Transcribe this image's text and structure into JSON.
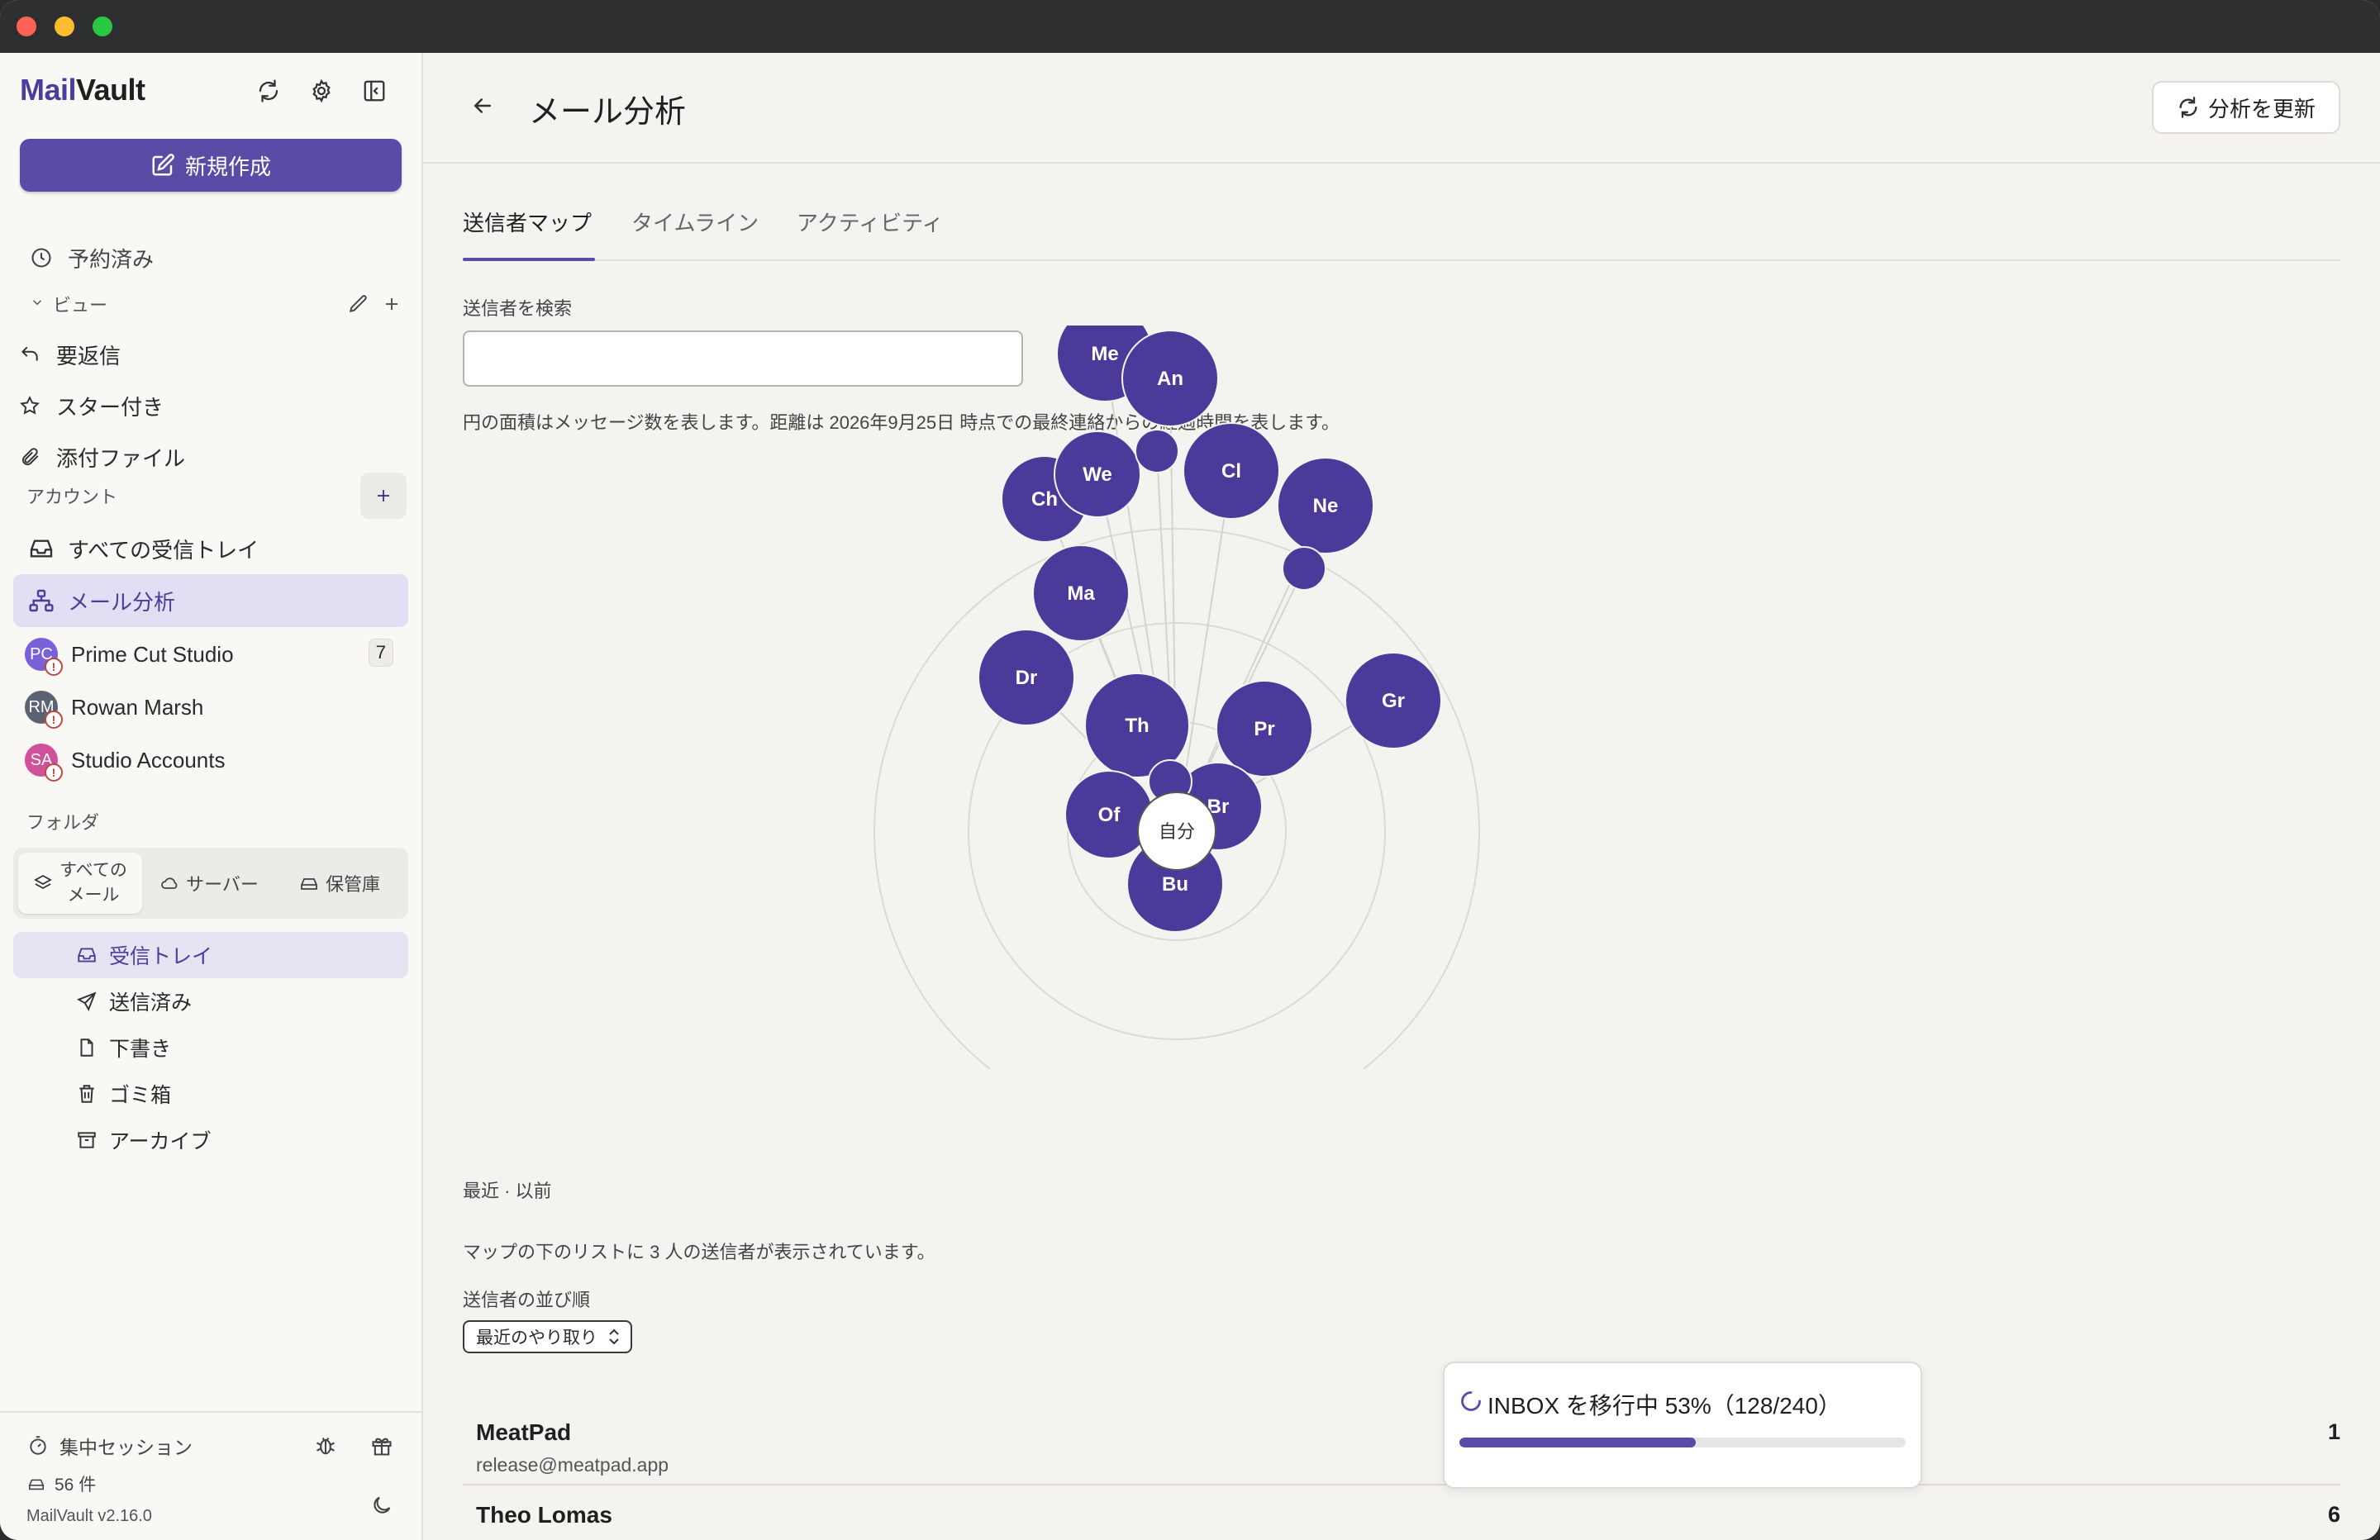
{
  "app": {
    "logo_part1": "Mail",
    "logo_part2": "Vault"
  },
  "sidebar": {
    "compose_label": "新規作成",
    "scheduled_label": "予約済み",
    "views_label": "ビュー",
    "views": [
      {
        "label": "要返信",
        "icon": "reply-icon"
      },
      {
        "label": "スター付き",
        "icon": "star-icon"
      },
      {
        "label": "添付ファイル",
        "icon": "paperclip-icon"
      }
    ],
    "accounts_label": "アカウント",
    "all_inboxes_label": "すべての受信トレイ",
    "mail_analytics_label": "メール分析",
    "accounts": [
      {
        "initials": "PC",
        "name": "Prime Cut Studio",
        "badge": "7",
        "color": "#7b61d9"
      },
      {
        "initials": "RM",
        "name": "Rowan Marsh",
        "badge": "",
        "color": "#5b6270"
      },
      {
        "initials": "SA",
        "name": "Studio Accounts",
        "badge": "",
        "color": "#d0509a"
      }
    ],
    "folders_label": "フォルダ",
    "segments": {
      "all": "すべての\nメール",
      "server": "サーバー",
      "vault": "保管庫"
    },
    "folders": [
      {
        "label": "受信トレイ",
        "icon": "inbox-icon"
      },
      {
        "label": "送信済み",
        "icon": "send-icon"
      },
      {
        "label": "下書き",
        "icon": "draft-icon"
      },
      {
        "label": "ゴミ箱",
        "icon": "trash-icon"
      },
      {
        "label": "アーカイブ",
        "icon": "archive-icon"
      }
    ],
    "footer": {
      "focus_label": "集中セッション",
      "count_label": "56 件",
      "version": "MailVault v2.16.0"
    }
  },
  "main": {
    "title": "メール分析",
    "refresh_label": "分析を更新",
    "tabs": [
      "送信者マップ",
      "タイムライン",
      "アクティビティ"
    ],
    "search_label": "送信者を検索",
    "search_value": "",
    "description": "円の面積はメッセージ数を表します。距離は 2026年9月25日 時点での最終連絡からの経過時間を表します。",
    "center_label": "自分",
    "bubbles": [
      "Me",
      "An",
      "Ch",
      "We",
      "Cl",
      "Ne",
      "Ma",
      "Dr",
      "Th",
      "Pr",
      "Gr",
      "Br",
      "Of",
      "Bu",
      "",
      "",
      ""
    ],
    "legend": "最近 · 以前",
    "list_note": "マップの下のリストに 3 人の送信者が表示されています。",
    "sort_label": "送信者の並び順",
    "sort_value": "最近のやり取り",
    "senders": [
      {
        "name": "MeatPad",
        "email": "release@meatpad.app",
        "count": "1"
      },
      {
        "name": "Theo Lomas",
        "email": "",
        "count": "6"
      }
    ]
  },
  "toast": {
    "text": "INBOX を移行中 53%（128/240）",
    "progress": 0.53
  },
  "colors": {
    "accent": "#594ba6",
    "bubble": "#4b3a9a",
    "danger": "#b84a3c"
  }
}
